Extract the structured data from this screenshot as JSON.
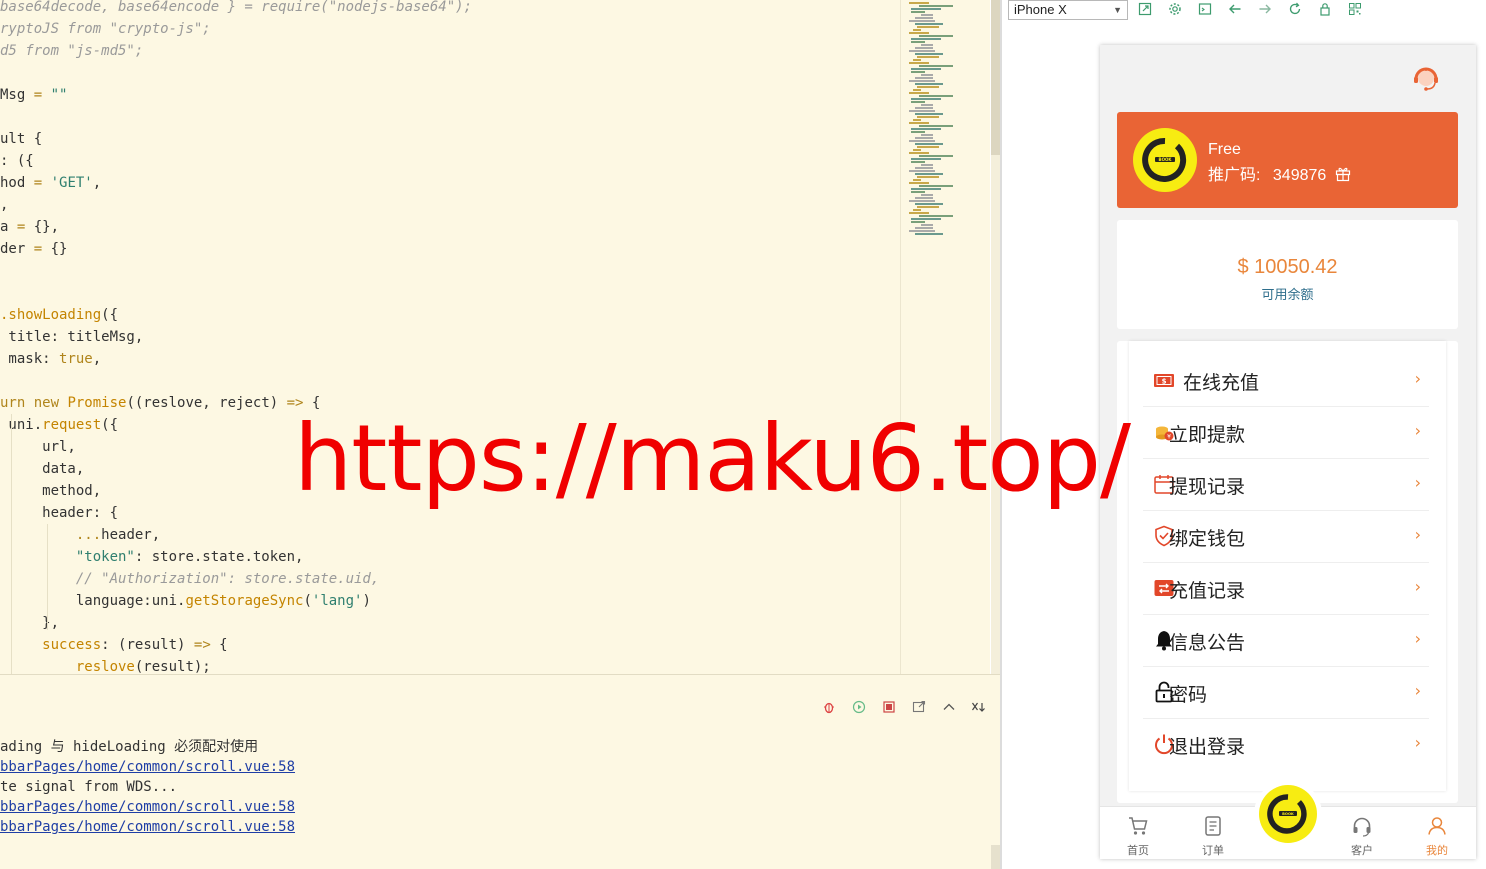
{
  "editor": {
    "lines": [
      [
        [
          "cm",
          "base64decode, base64encode } = require(\"nodejs-base64\");"
        ]
      ],
      [
        [
          "cm",
          "ryptoJS from \"crypto-js\";"
        ]
      ],
      [
        [
          "cm",
          "d5 from \"js-md5\";"
        ]
      ],
      [
        [
          "p",
          ""
        ]
      ],
      [
        [
          "p",
          "Msg "
        ],
        [
          "kw",
          "="
        ],
        [
          "p",
          " "
        ],
        [
          "str",
          "\"\""
        ]
      ],
      [
        [
          "p",
          ""
        ]
      ],
      [
        [
          "p",
          "ult {"
        ]
      ],
      [
        [
          "p",
          ": ({"
        ]
      ],
      [
        [
          "p",
          "hod "
        ],
        [
          "kw",
          "="
        ],
        [
          "p",
          " "
        ],
        [
          "str",
          "'GET'"
        ],
        [
          "p",
          ","
        ]
      ],
      [
        [
          "p",
          ","
        ]
      ],
      [
        [
          "p",
          "a "
        ],
        [
          "kw",
          "="
        ],
        [
          "p",
          " {},"
        ]
      ],
      [
        [
          "p",
          "der "
        ],
        [
          "kw",
          "="
        ],
        [
          "p",
          " {}"
        ]
      ],
      [
        [
          "p",
          ""
        ]
      ],
      [
        [
          "p",
          ""
        ]
      ],
      [
        [
          "fn",
          ".showLoading"
        ],
        [
          "p",
          "({"
        ]
      ],
      [
        [
          "p",
          " title: titleMsg,"
        ]
      ],
      [
        [
          "p",
          " mask: "
        ],
        [
          "kw",
          "true"
        ],
        [
          "p",
          ","
        ]
      ],
      [
        [
          "p",
          ""
        ]
      ],
      [
        [
          "kw",
          "urn new "
        ],
        [
          "fn",
          "Promise"
        ],
        [
          "p",
          "((reslove, reject) "
        ],
        [
          "kw",
          "=>"
        ],
        [
          "p",
          " {"
        ]
      ],
      [
        [
          "p",
          " uni."
        ],
        [
          "fn",
          "request"
        ],
        [
          "p",
          "({"
        ]
      ],
      [
        [
          "p",
          "     url,"
        ]
      ],
      [
        [
          "p",
          "     data,"
        ]
      ],
      [
        [
          "p",
          "     method,"
        ]
      ],
      [
        [
          "p",
          "     header: {"
        ]
      ],
      [
        [
          "p",
          "         "
        ],
        [
          "kw",
          "..."
        ],
        [
          "p",
          "header,"
        ]
      ],
      [
        [
          "p",
          "         "
        ],
        [
          "str",
          "\"token\""
        ],
        [
          "p",
          ": store.state.token,"
        ]
      ],
      [
        [
          "p",
          "         "
        ],
        [
          "cm",
          "// \"Authorization\": store.state.uid,"
        ]
      ],
      [
        [
          "p",
          "         language:uni."
        ],
        [
          "fn",
          "getStorageSync"
        ],
        [
          "p",
          "("
        ],
        [
          "str",
          "'lang'"
        ],
        [
          "p",
          ")"
        ]
      ],
      [
        [
          "p",
          "     },"
        ]
      ],
      [
        [
          "p",
          "     "
        ],
        [
          "fn",
          "success"
        ],
        [
          "p",
          ": (result) "
        ],
        [
          "kw",
          "=>"
        ],
        [
          "p",
          " {"
        ]
      ],
      [
        [
          "p",
          "         "
        ],
        [
          "fn",
          "reslove"
        ],
        [
          "p",
          "(result);"
        ]
      ]
    ]
  },
  "console": {
    "lines": [
      {
        "text": "ading 与 hideLoading 必须配对使用",
        "link": false
      },
      {
        "text": "bbarPages/home/common/scroll.vue:58",
        "link": true
      },
      {
        "text": "te signal from WDS...",
        "link": false
      },
      {
        "text": "bbarPages/home/common/scroll.vue:58",
        "link": true
      },
      {
        "text": "bbarPages/home/common/scroll.vue:58",
        "link": true
      }
    ]
  },
  "simulator": {
    "device": "iPhone X"
  },
  "app": {
    "user": {
      "name": "Free",
      "promo_label": "推广码:",
      "promo_code": "349876"
    },
    "balance": {
      "amount": "$ 10050.42",
      "label": "可用余额"
    },
    "menu": [
      {
        "label": "在线充值",
        "icon": "recharge-icon"
      },
      {
        "label": "立即提款",
        "icon": "withdraw-icon"
      },
      {
        "label": "提现记录",
        "icon": "withdraw-record-icon"
      },
      {
        "label": "绑定钱包",
        "icon": "wallet-shield-icon"
      },
      {
        "label": "充值记录",
        "icon": "recharge-record-icon"
      },
      {
        "label": "信息公告",
        "icon": "bell-icon"
      },
      {
        "label": "密码",
        "icon": "lock-icon"
      },
      {
        "label": "退出登录",
        "icon": "power-icon"
      }
    ],
    "tabs": [
      {
        "label": "首页",
        "icon": "cart-icon"
      },
      {
        "label": "订单",
        "icon": "order-icon"
      },
      {
        "label": "客户",
        "icon": "headset-icon"
      },
      {
        "label": "我的",
        "icon": "user-icon"
      }
    ],
    "accent": "#e96435",
    "highlight": "#e9863b"
  },
  "watermark": "https://maku6.top/"
}
